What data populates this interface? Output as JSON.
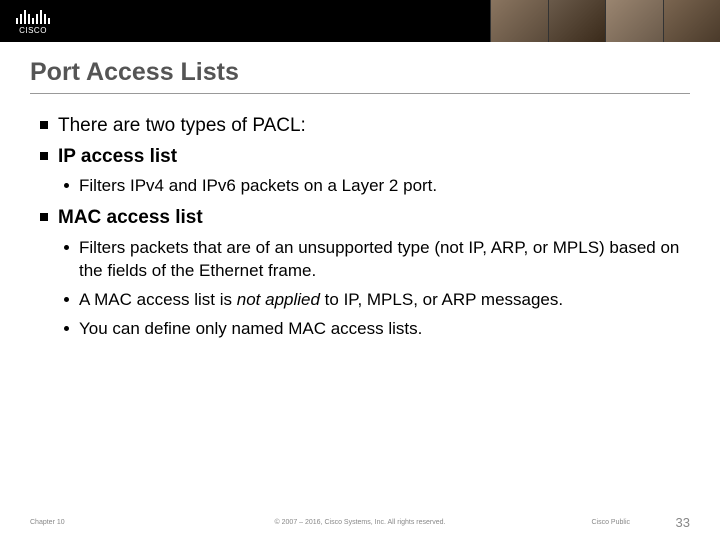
{
  "logo_text": "CISCO",
  "title": "Port Access Lists",
  "bullets": {
    "intro": "There are two types of PACL:",
    "ip_title": "IP access list",
    "ip_sub1": "Filters IPv4 and IPv6 packets on a Layer 2 port.",
    "mac_title": "MAC access list",
    "mac_sub1": "Filters packets that are of an unsupported type (not IP, ARP, or MPLS) based on the fields of the Ethernet frame.",
    "mac_sub2_pre": "A MAC access list is ",
    "mac_sub2_em": "not applied",
    "mac_sub2_post": " to IP, MPLS, or ARP messages.",
    "mac_sub3": "You can define only named MAC access lists."
  },
  "footer": {
    "chapter": "Chapter 10",
    "copyright": "© 2007 – 2016, Cisco Systems, Inc. All rights reserved.",
    "public": "Cisco Public",
    "page": "33"
  }
}
